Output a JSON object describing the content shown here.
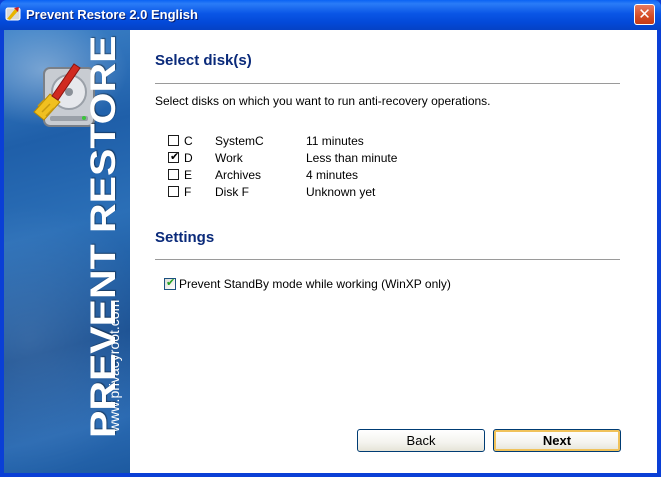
{
  "window": {
    "title": "Prevent Restore 2.0 English",
    "close_glyph": "✕"
  },
  "banner": {
    "brand": "PREVENT RESTORE",
    "url": "www.privacyroot.com",
    "logo_icon": "broom-hard-disk-icon"
  },
  "disks_section": {
    "title": "Select disk(s)",
    "description": "Select disks on which you want to run anti-recovery operations.",
    "disks": [
      {
        "letter": "C",
        "name": "SystemC",
        "time": "11 minutes",
        "checked": false
      },
      {
        "letter": "D",
        "name": "Work",
        "time": "Less than minute",
        "checked": true
      },
      {
        "letter": "E",
        "name": "Archives",
        "time": "4 minutes",
        "checked": false
      },
      {
        "letter": "F",
        "name": "Disk F",
        "time": "Unknown yet",
        "checked": false
      }
    ]
  },
  "settings_section": {
    "title": "Settings",
    "standby_label": "Prevent StandBy mode while working (WinXP only)",
    "standby_checked": true
  },
  "buttons": {
    "back": "Back",
    "next": "Next"
  },
  "colors": {
    "titlebar": "#0a56e6",
    "section_title": "#0a2a7a",
    "banner": "#1f5fa9",
    "close_button": "#d54c25"
  }
}
